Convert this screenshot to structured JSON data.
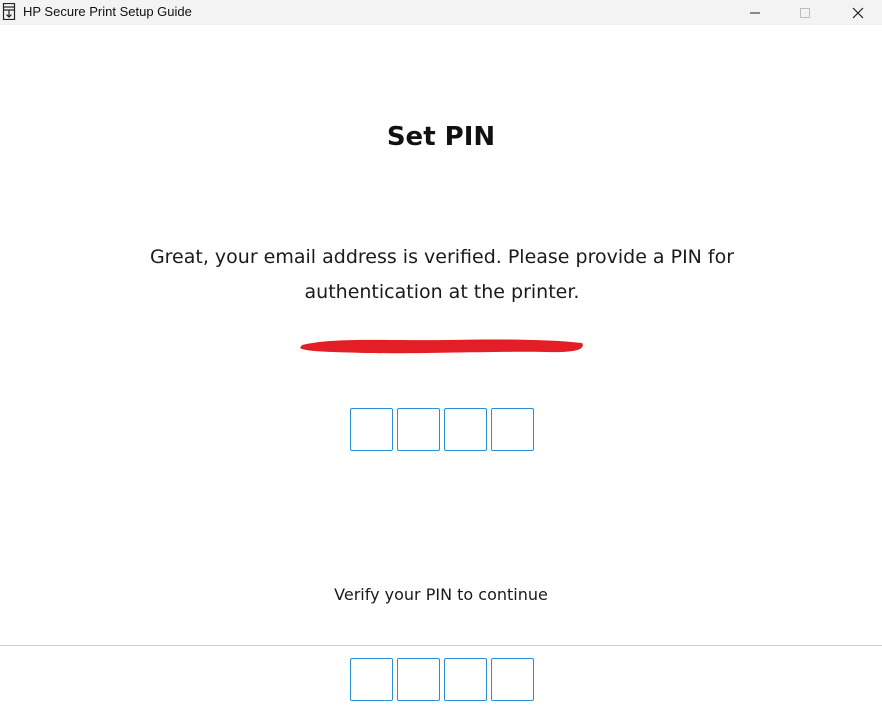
{
  "window": {
    "title": "HP Secure Print Setup Guide",
    "icon": "printer-icon",
    "controls": [
      "minimize-icon",
      "maximize-icon",
      "close-icon"
    ]
  },
  "page": {
    "heading": "Set PIN",
    "instructions": "Great, your email address is verified. Please provide a PIN for authentication at the printer.",
    "email": "",
    "email_redacted": true,
    "redaction_color": "#e41e26"
  },
  "pin": {
    "digits": 4,
    "values": [
      "",
      "",
      "",
      ""
    ]
  },
  "verify": {
    "label": "Verify your PIN to continue",
    "values": [
      "",
      "",
      "",
      ""
    ]
  },
  "colors": {
    "pin_border": "#2a8fd4",
    "titlebar_bg": "#f3f3f3",
    "divider": "#cfcfcf"
  }
}
